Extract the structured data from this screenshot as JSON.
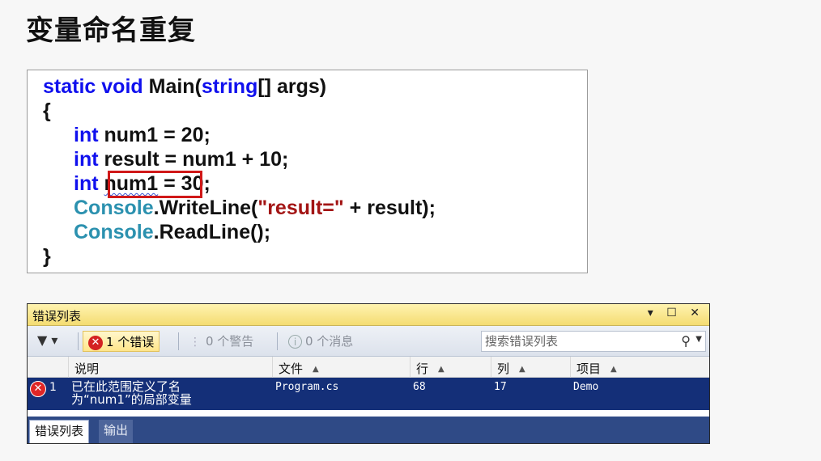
{
  "slide": {
    "title": "变量命名重复"
  },
  "code": {
    "line1": {
      "kw1": "static",
      "kw2": "void",
      "t1": " Main(",
      "kw3": "string",
      "t2": "[] args)"
    },
    "line2": "{",
    "line3": {
      "kw": "int",
      "rest": " num1 = 20;"
    },
    "line4": {
      "kw": "int",
      "rest": " result = num1 + 10;"
    },
    "line5": {
      "kw": "int",
      "ident": "num1",
      "rest": " = 30;"
    },
    "line6": {
      "type": "Console",
      "mid": ".WriteLine(",
      "str": "\"result=\"",
      "rest": " + result);"
    },
    "line7": {
      "type": "Console",
      "rest": ".ReadLine();"
    },
    "line8": "}"
  },
  "panel": {
    "title": "错误列表",
    "controls": "▾ ☐ ✕",
    "toolbar": {
      "filter_icon": "▼ ▾",
      "errors_label": "1 个错误",
      "warnings_label": "0 个警告",
      "messages_label": "0 个消息",
      "search_placeholder": "搜索错误列表"
    },
    "columns": {
      "description": "说明",
      "file": "文件",
      "line": "行",
      "column": "列",
      "project": "项目"
    },
    "rows": [
      {
        "index": "1",
        "description": "已在此范围定义了名\n为“num1”的局部变量",
        "file": "Program.cs",
        "line": "68",
        "column": "17",
        "project": "Demo"
      }
    ],
    "tabs": [
      "错误列表",
      "输出"
    ]
  },
  "colors": {
    "keyword": "#1010ee",
    "type": "#2b91af",
    "string": "#a31515",
    "highlight_box": "#d01818",
    "selected_row": "#142f78",
    "panel_title": "#f4dc72"
  }
}
